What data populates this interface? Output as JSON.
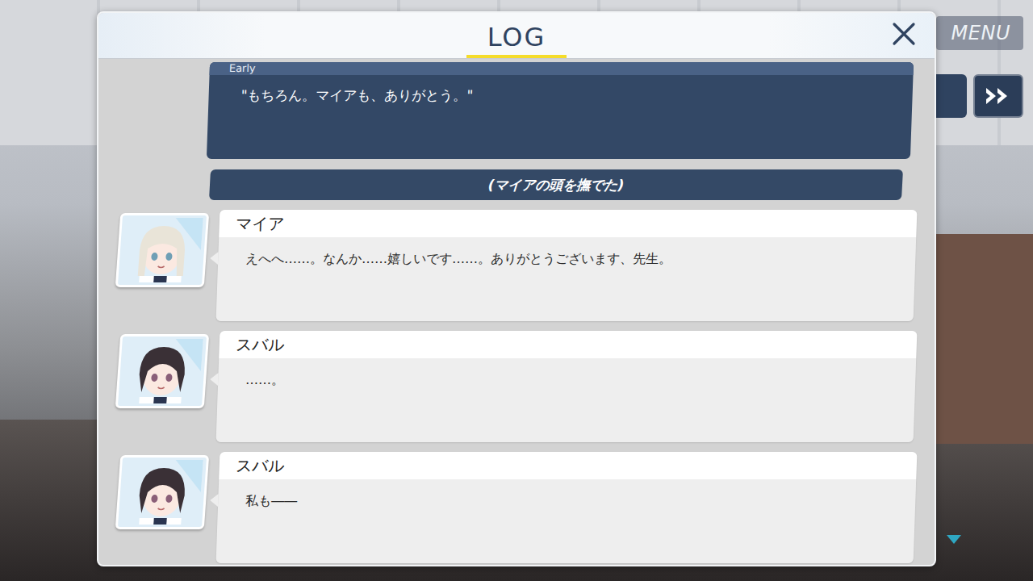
{
  "menu": {
    "label": "MENU"
  },
  "log": {
    "title": "LOG"
  },
  "entries": [
    {
      "kind": "choice",
      "speaker": "Early",
      "text": "\"もちろん。マイアも、ありがとう。\""
    },
    {
      "kind": "action",
      "text": "(マイアの頭を撫でた)"
    },
    {
      "kind": "dialogue",
      "speaker": "マイア",
      "text": "えへへ……。なんか……嬉しいです……。ありがとうございます、先生。",
      "character": "maia"
    },
    {
      "kind": "dialogue",
      "speaker": "スバル",
      "text": "……。",
      "character": "subaru"
    },
    {
      "kind": "dialogue",
      "speaker": "スバル",
      "text": "私も――",
      "character": "subaru"
    }
  ]
}
